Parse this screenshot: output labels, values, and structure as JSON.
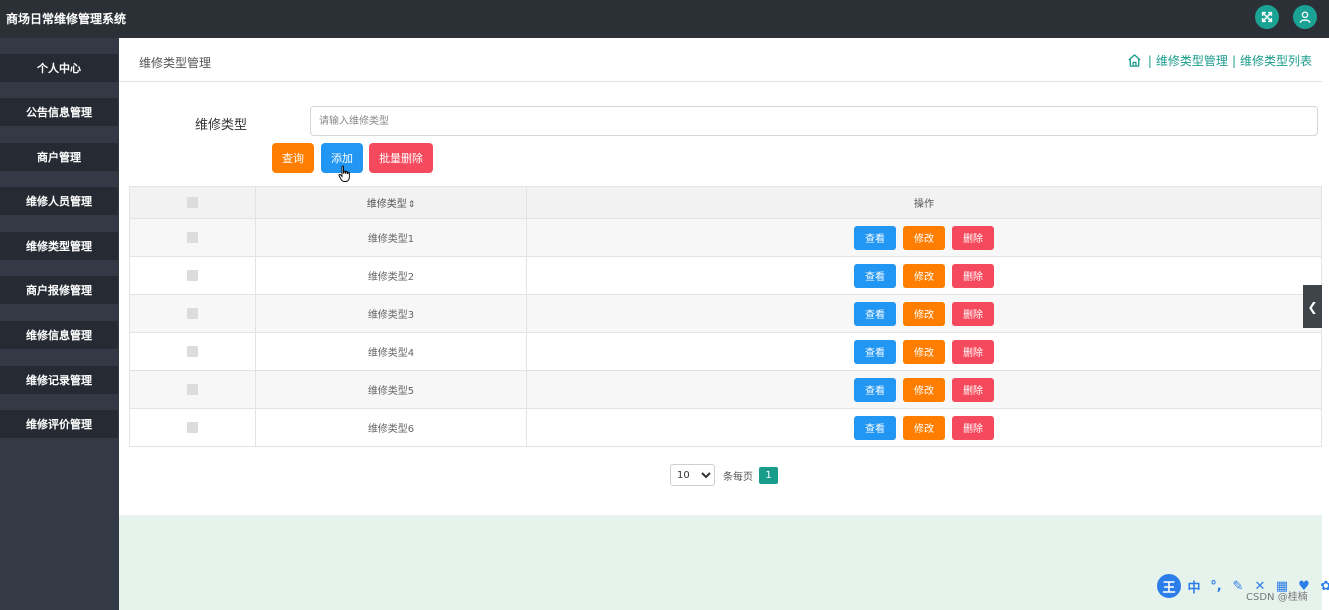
{
  "app": {
    "title": "商场日常维修管理系统"
  },
  "sidebar": {
    "items": [
      {
        "label": "个人中心"
      },
      {
        "label": "公告信息管理"
      },
      {
        "label": "商户管理"
      },
      {
        "label": "维修人员管理"
      },
      {
        "label": "维修类型管理"
      },
      {
        "label": "商户报修管理"
      },
      {
        "label": "维修信息管理"
      },
      {
        "label": "维修记录管理"
      },
      {
        "label": "维修评价管理"
      }
    ]
  },
  "page": {
    "title": "维修类型管理",
    "breadcrumb": [
      "维修类型管理",
      "维修类型列表"
    ],
    "breadcrumb_sep": "|"
  },
  "search": {
    "label": "维修类型",
    "placeholder": "请输入维修类型",
    "value": ""
  },
  "buttons": {
    "query": "查询",
    "add": "添加",
    "batch_delete": "批量删除"
  },
  "table": {
    "columns": [
      "",
      "维修类型",
      "操作"
    ],
    "sort_icon": "⇕",
    "rows": [
      {
        "type": "维修类型1"
      },
      {
        "type": "维修类型2"
      },
      {
        "type": "维修类型3"
      },
      {
        "type": "维修类型4"
      },
      {
        "type": "维修类型5"
      },
      {
        "type": "维修类型6"
      }
    ],
    "actions": {
      "view": "查看",
      "edit": "修改",
      "delete": "删除"
    }
  },
  "pagination": {
    "page_size_options": [
      "10"
    ],
    "page_size": "10",
    "per_page_label": "条每页",
    "current_page": "1"
  },
  "ime": {
    "items": [
      "中",
      "°,",
      "✎",
      "✕",
      "▦",
      "♥",
      "✿"
    ]
  },
  "watermark": "CSDN @桂楠",
  "colors": {
    "topbar": "#2b2f36",
    "sidebar": "#343a45",
    "menu_item": "#252a33",
    "accent": "#1a9c8c",
    "orange": "#ff7e00",
    "blue": "#2196f3",
    "red": "#f54a5d"
  },
  "icons": {
    "fullscreen": "fullscreen-icon",
    "user": "user-icon",
    "home": "home-icon",
    "collapse": "chevron-left-icon"
  }
}
